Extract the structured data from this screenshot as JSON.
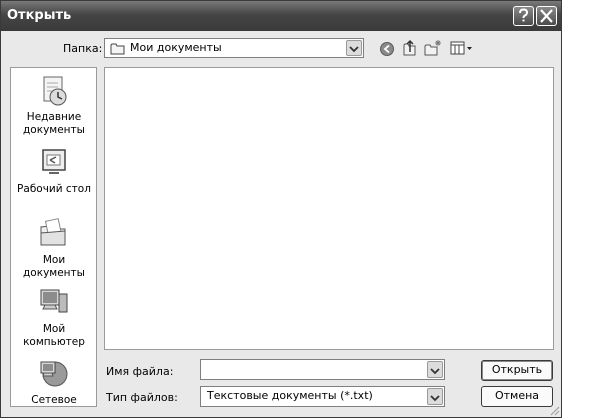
{
  "window": {
    "title": "Открыть"
  },
  "toolbar": {
    "folder_label": "Папка:",
    "folder_value": "Мои документы"
  },
  "places": [
    {
      "label": "Недавние документы",
      "icon": "recent-documents-icon"
    },
    {
      "label": "Рабочий стол",
      "icon": "desktop-icon"
    },
    {
      "label": "Мои документы",
      "icon": "my-documents-icon"
    },
    {
      "label": "Мой компьютер",
      "icon": "my-computer-icon"
    },
    {
      "label": "Сетевое",
      "icon": "network-icon"
    }
  ],
  "filename": {
    "label": "Имя файла:",
    "value": ""
  },
  "filetype": {
    "label": "Тип файлов:",
    "value": "Текстовые документы (*.txt)"
  },
  "buttons": {
    "open": "Открыть",
    "cancel": "Отмена"
  }
}
